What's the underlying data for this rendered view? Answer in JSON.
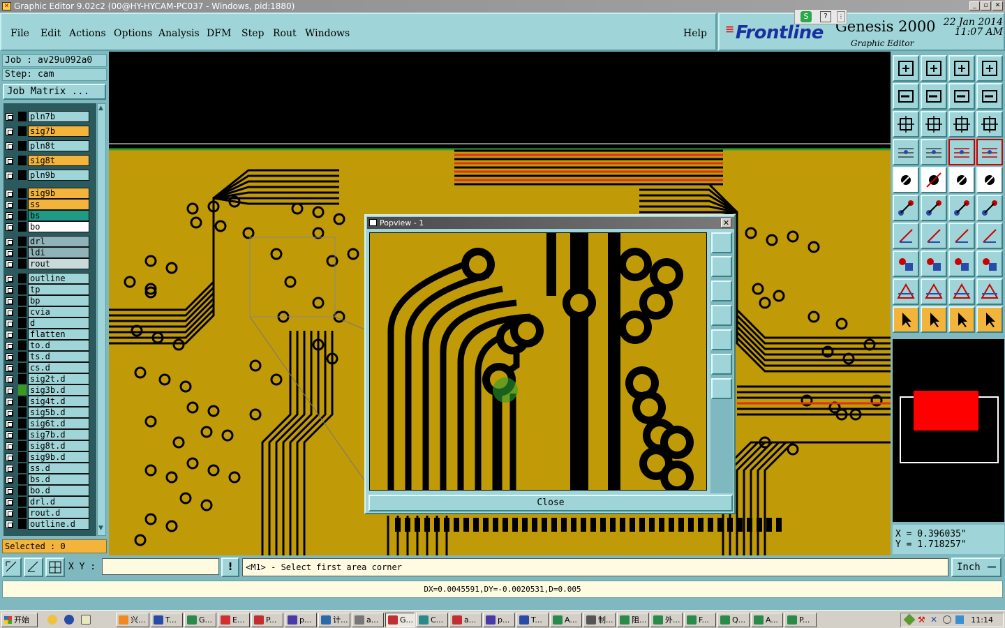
{
  "window": {
    "title": "Graphic Editor 9.02c2 (00@HY-HYCAM-PC037 - Windows, pid:1880)"
  },
  "menu": [
    "File",
    "Edit",
    "Actions",
    "Options",
    "Analysis",
    "DFM",
    "Step",
    "Rout",
    "Windows"
  ],
  "help": "Help",
  "brand": {
    "logo": "Frontline",
    "product": "Genesis 2000",
    "subtitle": "Graphic Editor",
    "date": "22 Jan 2014",
    "time": "11:07 AM"
  },
  "job": {
    "job_label": "Job : av29u092a0",
    "step_label": "Step: cam",
    "matrix_button": "Job Matrix ..."
  },
  "layers": [
    {
      "name": "pln7b",
      "color": "#9fd5d8"
    },
    {
      "name": "sig7b",
      "color": "#f3b43c"
    },
    {
      "name": "pln8t",
      "color": "#9fd5d8"
    },
    {
      "name": "sig8t",
      "color": "#f3b43c"
    },
    {
      "name": "pln9b",
      "color": "#9fd5d8"
    },
    {
      "name": "sig9b",
      "color": "#f3b43c"
    },
    {
      "name": "ss",
      "color": "#f3b43c"
    },
    {
      "name": "bs",
      "color": "#1f9a86"
    },
    {
      "name": "bo",
      "color": "#ffffff"
    },
    {
      "name": "drl",
      "color": "#8fb3b8"
    },
    {
      "name": "ldi",
      "color": "#8fb3b8"
    },
    {
      "name": "rout",
      "color": "#c9dada"
    },
    {
      "name": "outline",
      "color": "#9fd5d8"
    },
    {
      "name": "tp",
      "color": "#9fd5d8"
    },
    {
      "name": "bp",
      "color": "#9fd5d8"
    },
    {
      "name": "cvia",
      "color": "#9fd5d8"
    },
    {
      "name": "d",
      "color": "#9fd5d8"
    },
    {
      "name": "flatten",
      "color": "#9fd5d8"
    },
    {
      "name": "to.d",
      "color": "#9fd5d8"
    },
    {
      "name": "ts.d",
      "color": "#9fd5d8"
    },
    {
      "name": "cs.d",
      "color": "#9fd5d8"
    },
    {
      "name": "sig2t.d",
      "color": "#9fd5d8"
    },
    {
      "name": "sig3b.d",
      "color": "#9fd5d8"
    },
    {
      "name": "sig4t.d",
      "color": "#9fd5d8"
    },
    {
      "name": "sig5b.d",
      "color": "#9fd5d8"
    },
    {
      "name": "sig6t.d",
      "color": "#9fd5d8"
    },
    {
      "name": "sig7b.d",
      "color": "#9fd5d8"
    },
    {
      "name": "sig8t.d",
      "color": "#9fd5d8"
    },
    {
      "name": "sig9b.d",
      "color": "#9fd5d8"
    },
    {
      "name": "ss.d",
      "color": "#9fd5d8"
    },
    {
      "name": "bs.d",
      "color": "#9fd5d8"
    },
    {
      "name": "bo.d",
      "color": "#9fd5d8"
    },
    {
      "name": "drl.d",
      "color": "#9fd5d8"
    },
    {
      "name": "rout.d",
      "color": "#9fd5d8"
    },
    {
      "name": "outline.d",
      "color": "#9fd5d8"
    }
  ],
  "selected": "Selected : 0",
  "popview": {
    "title": "Popview - 1",
    "close_label": "Close"
  },
  "coords": {
    "x": "X = 0.396035\"",
    "y": "Y = 1.718257\""
  },
  "command": {
    "xy_label": "X Y :",
    "xy_value": "",
    "prompt": "<M1> - Select first area corner",
    "unit": "Inch"
  },
  "status": "DX=0.0045591,DY=-0.0020531,D=0.005",
  "taskbar": {
    "start": "开始",
    "tasks": [
      "兴...",
      "T...",
      "G...",
      "E...",
      "P...",
      "p...",
      "计...",
      "a...",
      "G...",
      "C...",
      "a...",
      "p...",
      "T...",
      "A...",
      "制...",
      "阻...",
      "外...",
      "F...",
      "Q...",
      "A...",
      "P..."
    ],
    "clock": "11:14"
  },
  "colors": {
    "board": "#c19a07",
    "copper": "#000000",
    "panel": "#9fd5d8",
    "highlight": "#f3b43c"
  }
}
